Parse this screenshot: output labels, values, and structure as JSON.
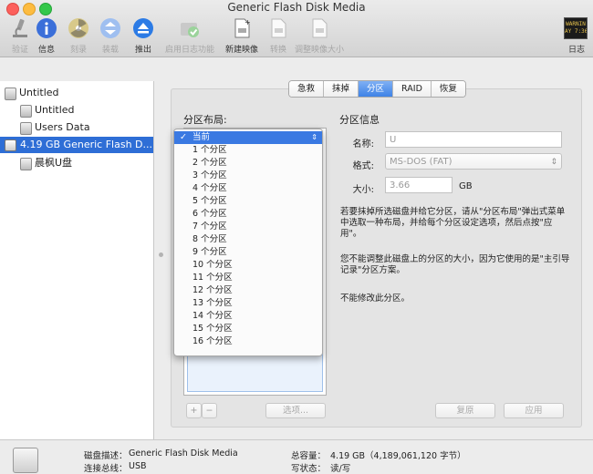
{
  "window": {
    "title": "Generic Flash Disk Media"
  },
  "toolbar": {
    "verify": "验证",
    "info": "信息",
    "burn": "刻录",
    "mount": "装载",
    "eject": "推出",
    "enable_journal": "启用日志功能",
    "new_image": "新建映像",
    "convert": "转换",
    "resize_image": "调整映像大小",
    "log": "日志",
    "log_icon_text": "WARNIN\nAY 7:36"
  },
  "sidebar": {
    "items": [
      {
        "label": "Untitled"
      },
      {
        "label": "Untitled"
      },
      {
        "label": "Users Data"
      },
      {
        "label": "4.19 GB Generic Flash D..."
      },
      {
        "label": "晨枫U盘"
      }
    ]
  },
  "tabs": [
    {
      "label": "急救"
    },
    {
      "label": "抹掉"
    },
    {
      "label": "分区",
      "active": true
    },
    {
      "label": "RAID"
    },
    {
      "label": "恢复"
    }
  ],
  "partition": {
    "layout_header": "分区布局:",
    "info_header": "分区信息",
    "name_label": "名称:",
    "name_value": "U",
    "format_label": "格式:",
    "format_value": "MS-DOS (FAT)",
    "size_label": "大小:",
    "size_value": "3.66",
    "size_unit": "GB",
    "help1": "若要抹掉所选磁盘并给它分区，请从\"分区布局\"弹出式菜单中选取一种布局，并给每个分区设定选项，然后点按\"应用\"。",
    "help2": "您不能调整此磁盘上的分区的大小，因为它使用的是\"主引导记录\"分区方案。",
    "help3": "不能修改此分区。",
    "add_btn": "+",
    "remove_btn": "−",
    "options_btn": "选项...",
    "revert_btn": "复原",
    "apply_btn": "应用"
  },
  "layout_menu": {
    "selected": "当前",
    "items": [
      "1 个分区",
      "2 个分区",
      "3 个分区",
      "4 个分区",
      "5 个分区",
      "6 个分区",
      "7 个分区",
      "8 个分区",
      "9 个分区",
      "10 个分区",
      "11 个分区",
      "12 个分区",
      "13 个分区",
      "14 个分区",
      "15 个分区",
      "16 个分区"
    ]
  },
  "bottom": {
    "disk_desc_label": "磁盘描述：",
    "disk_desc_value": "Generic Flash Disk Media",
    "bus_label": "连接总线：",
    "bus_value": "USB",
    "capacity_label": "总容量：",
    "capacity_value": "4.19 GB（4,189,061,120 字节）",
    "write_label": "写状态：",
    "write_value": "读/写"
  },
  "colors": {
    "selection": "#2e6ed6",
    "accent_tab": "#3e82e6"
  }
}
